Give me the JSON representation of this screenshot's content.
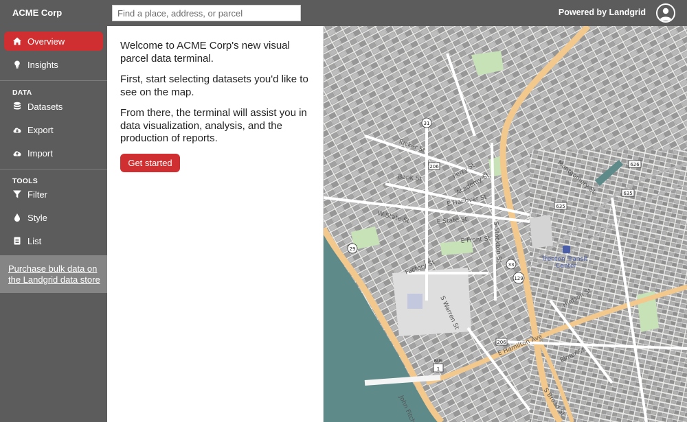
{
  "header": {
    "brand": "ACME Corp",
    "search_placeholder": "Find a place, address, or parcel",
    "powered_by": "Powered by Landgrid"
  },
  "sidebar": {
    "items": [
      {
        "label": "Overview",
        "icon": "home-icon",
        "active": true
      },
      {
        "label": "Insights",
        "icon": "lightbulb-icon"
      }
    ],
    "sections": [
      {
        "label": "DATA",
        "items": [
          {
            "label": "Datasets",
            "icon": "database-icon"
          },
          {
            "label": "Export",
            "icon": "cloud-download-icon"
          },
          {
            "label": "Import",
            "icon": "cloud-upload-icon"
          }
        ]
      },
      {
        "label": "TOOLS",
        "items": [
          {
            "label": "Filter",
            "icon": "filter-icon"
          },
          {
            "label": "Style",
            "icon": "droplet-icon"
          },
          {
            "label": "List",
            "icon": "list-icon"
          }
        ]
      }
    ],
    "purchase_line1": "Purchase bulk data on",
    "purchase_line2": "the Landgrid data store"
  },
  "panel": {
    "paragraphs": [
      "Welcome to ACME Corp's new visual parcel data terminal.",
      "First, start selecting datasets you'd like to see on the map.",
      "From there, the terminal will assist you in data visualization, analysis, and the production of reports."
    ],
    "cta": "Get started"
  },
  "map": {
    "labels": {
      "bank_st": "Bank St",
      "w_state_st": "W State St",
      "e_state_st": "E State St",
      "e_hanover_st": "E Hanover St",
      "e_front_st": "E Front St",
      "s_stockton_st": "S Stockton St",
      "factory_st": "Factory St",
      "s_warren_st": "S Warren St",
      "e_hamilton_ave": "E Hamilton Ave",
      "s_broad_st": "S Broad St",
      "john_fitch": "John Fitch",
      "transit_center": "Trenton Transit",
      "transit_center_2": "Center",
      "tucker_st": "Tucker St",
      "perry_st": "Perry St",
      "academy_st": "Academy St",
      "montgomery_st": "Montgomery St",
      "hudson_st": "Hudson St",
      "elmer_st": "Elmer St"
    },
    "shields": [
      "31",
      "29",
      "33",
      "129",
      "206",
      "626",
      "635",
      "635",
      "206",
      "1",
      "BUS"
    ]
  },
  "colors": {
    "accent": "#cf2f30",
    "sidebar": "#5c5c5c",
    "water": "#5e8a8a",
    "highway": "#f3c88c",
    "park": "#c8e2b8"
  }
}
